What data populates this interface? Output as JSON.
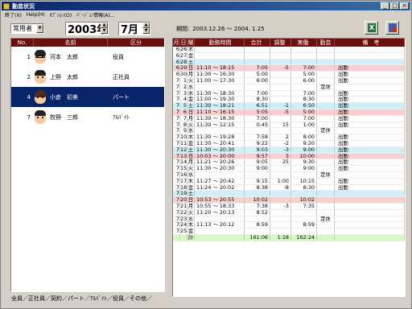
{
  "window": {
    "title": "勤怠状況",
    "controls": [
      "_",
      "□",
      "×"
    ]
  },
  "menu": [
    "終了(X)",
    "Help(H)",
    "ｵﾌﾟｼｮﾝ(O)",
    "ﾊﾞｰｼﾞｮﾝ情報(A)..."
  ],
  "filter": {
    "employment_type": "常用者"
  },
  "year": "2003年",
  "month": "7月",
  "period": {
    "label": "期間:",
    "value": "2003.12.26 ～ 2004. 1.25"
  },
  "toolbar": {
    "excel_label": "X",
    "exit_icon": "exit-icon"
  },
  "employees": {
    "headers": [
      "No.",
      "名前",
      "区分"
    ],
    "rows": [
      {
        "no": "1",
        "name": "河本　太郎",
        "kubun": "役員",
        "selected": false,
        "avatar": "man-glasses"
      },
      {
        "no": "2",
        "name": "上野　太郎",
        "kubun": "正社員",
        "selected": false,
        "avatar": "man"
      },
      {
        "no": "4",
        "name": "小倉　初美",
        "kubun": "パート",
        "selected": true,
        "avatar": "woman"
      },
      {
        "no": "7",
        "name": "牧野　三郎",
        "kubun": "ｱﾙﾊﾞｲﾄ",
        "selected": false,
        "avatar": "man"
      }
    ]
  },
  "tabs": "全員／正社員／契約／パート／ｱﾙﾊﾞｲﾄ／役員／その他／",
  "attendance": {
    "headers": [
      "月",
      "日",
      "曜",
      "勤務時間",
      "合計",
      "調整",
      "実働",
      "勤怠",
      "備　考"
    ],
    "rows": [
      {
        "m": "6",
        "d": "26",
        "w": "木",
        "time": "",
        "total": "",
        "adj": "",
        "work": "",
        "kintai": "",
        "note": "",
        "hl": ""
      },
      {
        "m": "6",
        "d": "27",
        "w": "金",
        "time": "",
        "total": "",
        "adj": "",
        "work": "",
        "kintai": "",
        "note": "",
        "hl": ""
      },
      {
        "m": "6",
        "d": "28",
        "w": "土",
        "time": "",
        "total": "",
        "adj": "",
        "work": "",
        "kintai": "",
        "note": "",
        "hl": "blue"
      },
      {
        "m": "6",
        "d": "29",
        "w": "日",
        "time": "11:10 ～ 18:15",
        "total": "7:05",
        "adj": "-5",
        "work": "7:00",
        "kintai": "",
        "note": "出勤",
        "hl": "red"
      },
      {
        "m": "6",
        "d": "30",
        "w": "月",
        "time": "11:30 ～ 16:30",
        "total": "5:00",
        "adj": "",
        "work": "5:00",
        "kintai": "",
        "note": "出勤",
        "hl": ""
      },
      {
        "m": "7",
        "d": "1",
        "w": "火",
        "time": "11:00 ～ 17:30",
        "total": "6:00",
        "adj": "",
        "work": "6:00",
        "kintai": "",
        "note": "出勤",
        "hl": ""
      },
      {
        "m": "7",
        "d": "2",
        "w": "水",
        "time": "",
        "total": "",
        "adj": "",
        "work": "",
        "kintai": "定休",
        "note": "",
        "hl": ""
      },
      {
        "m": "7",
        "d": "3",
        "w": "木",
        "time": "11:30 ～ 18:30",
        "total": "7:00",
        "adj": "",
        "work": "7:00",
        "kintai": "",
        "note": "出勤",
        "hl": ""
      },
      {
        "m": "7",
        "d": "4",
        "w": "金",
        "time": "11:00 ～ 19:30",
        "total": "8:30",
        "adj": "",
        "work": "8:30",
        "kintai": "",
        "note": "出勤",
        "hl": ""
      },
      {
        "m": "7",
        "d": "5",
        "w": "土",
        "time": "11:30 ～ 18:21",
        "total": "6:51",
        "adj": "-1",
        "work": "6:50",
        "kintai": "",
        "note": "出勤",
        "hl": "blue"
      },
      {
        "m": "7",
        "d": "6",
        "w": "日",
        "time": "11:10 ～ 16:15",
        "total": "5:05",
        "adj": "-5",
        "work": "5:00",
        "kintai": "",
        "note": "出勤",
        "hl": "red"
      },
      {
        "m": "7",
        "d": "7",
        "w": "月",
        "time": "11:30 ～ 18:30",
        "total": "7:00",
        "adj": "",
        "work": "7:00",
        "kintai": "",
        "note": "出勤",
        "hl": ""
      },
      {
        "m": "7",
        "d": "8",
        "w": "火",
        "time": "11:30 ～ 12:15",
        "total": "0:45",
        "adj": "15",
        "work": "1:00",
        "kintai": "",
        "note": "出勤",
        "hl": ""
      },
      {
        "m": "7",
        "d": "9",
        "w": "水",
        "time": "",
        "total": "",
        "adj": "",
        "work": "",
        "kintai": "定休",
        "note": "",
        "hl": ""
      },
      {
        "m": "7",
        "d": "10",
        "w": "木",
        "time": "11:30 ～ 19:28",
        "total": "7:58",
        "adj": "2",
        "work": "8:00",
        "kintai": "",
        "note": "出勤",
        "hl": ""
      },
      {
        "m": "7",
        "d": "11",
        "w": "金",
        "time": "11:30 ～ 20:41",
        "total": "9:22",
        "adj": "-2",
        "work": "9:20",
        "kintai": "",
        "note": "出勤",
        "hl": ""
      },
      {
        "m": "7",
        "d": "12",
        "w": "土",
        "time": "11:30 ～ 20:30",
        "total": "9:03",
        "adj": "-3",
        "work": "9:00",
        "kintai": "",
        "note": "出勤",
        "hl": "blue"
      },
      {
        "m": "7",
        "d": "13",
        "w": "日",
        "time": "10:03 ～ 20:00",
        "total": "9:57",
        "adj": "3",
        "work": "10:00",
        "kintai": "",
        "note": "出勤",
        "hl": "red"
      },
      {
        "m": "7",
        "d": "14",
        "w": "月",
        "time": "11:21 ～ 20:26",
        "total": "9:05",
        "adj": "25",
        "work": "9:30",
        "kintai": "",
        "note": "出勤",
        "hl": ""
      },
      {
        "m": "7",
        "d": "15",
        "w": "火",
        "time": "11:30 ～ 20:30",
        "total": "9:00",
        "adj": "",
        "work": "9:00",
        "kintai": "",
        "note": "出勤",
        "hl": ""
      },
      {
        "m": "7",
        "d": "16",
        "w": "水",
        "time": "",
        "total": "",
        "adj": "",
        "work": "",
        "kintai": "定休",
        "note": "",
        "hl": ""
      },
      {
        "m": "7",
        "d": "17",
        "w": "木",
        "time": "11:27 ～ 20:42",
        "total": "9:15",
        "adj": "1:00",
        "work": "10:15",
        "kintai": "",
        "note": "出勤",
        "hl": ""
      },
      {
        "m": "7",
        "d": "18",
        "w": "金",
        "time": "11:24 ～ 20:02",
        "total": "8:38",
        "adj": "-8",
        "work": "8:30",
        "kintai": "",
        "note": "出勤",
        "hl": ""
      },
      {
        "m": "7",
        "d": "19",
        "w": "土",
        "time": "",
        "total": "",
        "adj": "",
        "work": "",
        "kintai": "",
        "note": "",
        "hl": "blue"
      },
      {
        "m": "7",
        "d": "20",
        "w": "日",
        "time": "10:53 ～ 20:55",
        "total": "10:02",
        "adj": "",
        "work": "10:02",
        "kintai": "",
        "note": "",
        "hl": "red"
      },
      {
        "m": "7",
        "d": "21",
        "w": "月",
        "time": "10:55 ～ 18:33",
        "total": "7:38",
        "adj": "-3",
        "work": "7:35",
        "kintai": "",
        "note": "",
        "hl": ""
      },
      {
        "m": "7",
        "d": "22",
        "w": "火",
        "time": "11:20 ～ 20:13",
        "total": "8:52",
        "adj": "",
        "work": "",
        "kintai": "",
        "note": "",
        "hl": ""
      },
      {
        "m": "7",
        "d": "23",
        "w": "水",
        "time": "",
        "total": "",
        "adj": "",
        "work": "",
        "kintai": "定休",
        "note": "",
        "hl": ""
      },
      {
        "m": "7",
        "d": "24",
        "w": "木",
        "time": "11:13 ～ 20:12",
        "total": "8:59",
        "adj": "",
        "work": "8:59",
        "kintai": "",
        "note": "",
        "hl": ""
      },
      {
        "m": "7",
        "d": "25",
        "w": "金",
        "time": "",
        "total": "",
        "adj": "",
        "work": "",
        "kintai": "",
        "note": "",
        "hl": ""
      }
    ],
    "total_row": {
      "label": "計",
      "total": "161:06",
      "adj": "1:18",
      "work": "162:24"
    }
  },
  "colors": {
    "header_bg": "#6b0e0e",
    "sunday": "#f8d0d0",
    "saturday": "#d0f0f8",
    "total": "#d8f8c8",
    "selected": "#0a246a"
  }
}
